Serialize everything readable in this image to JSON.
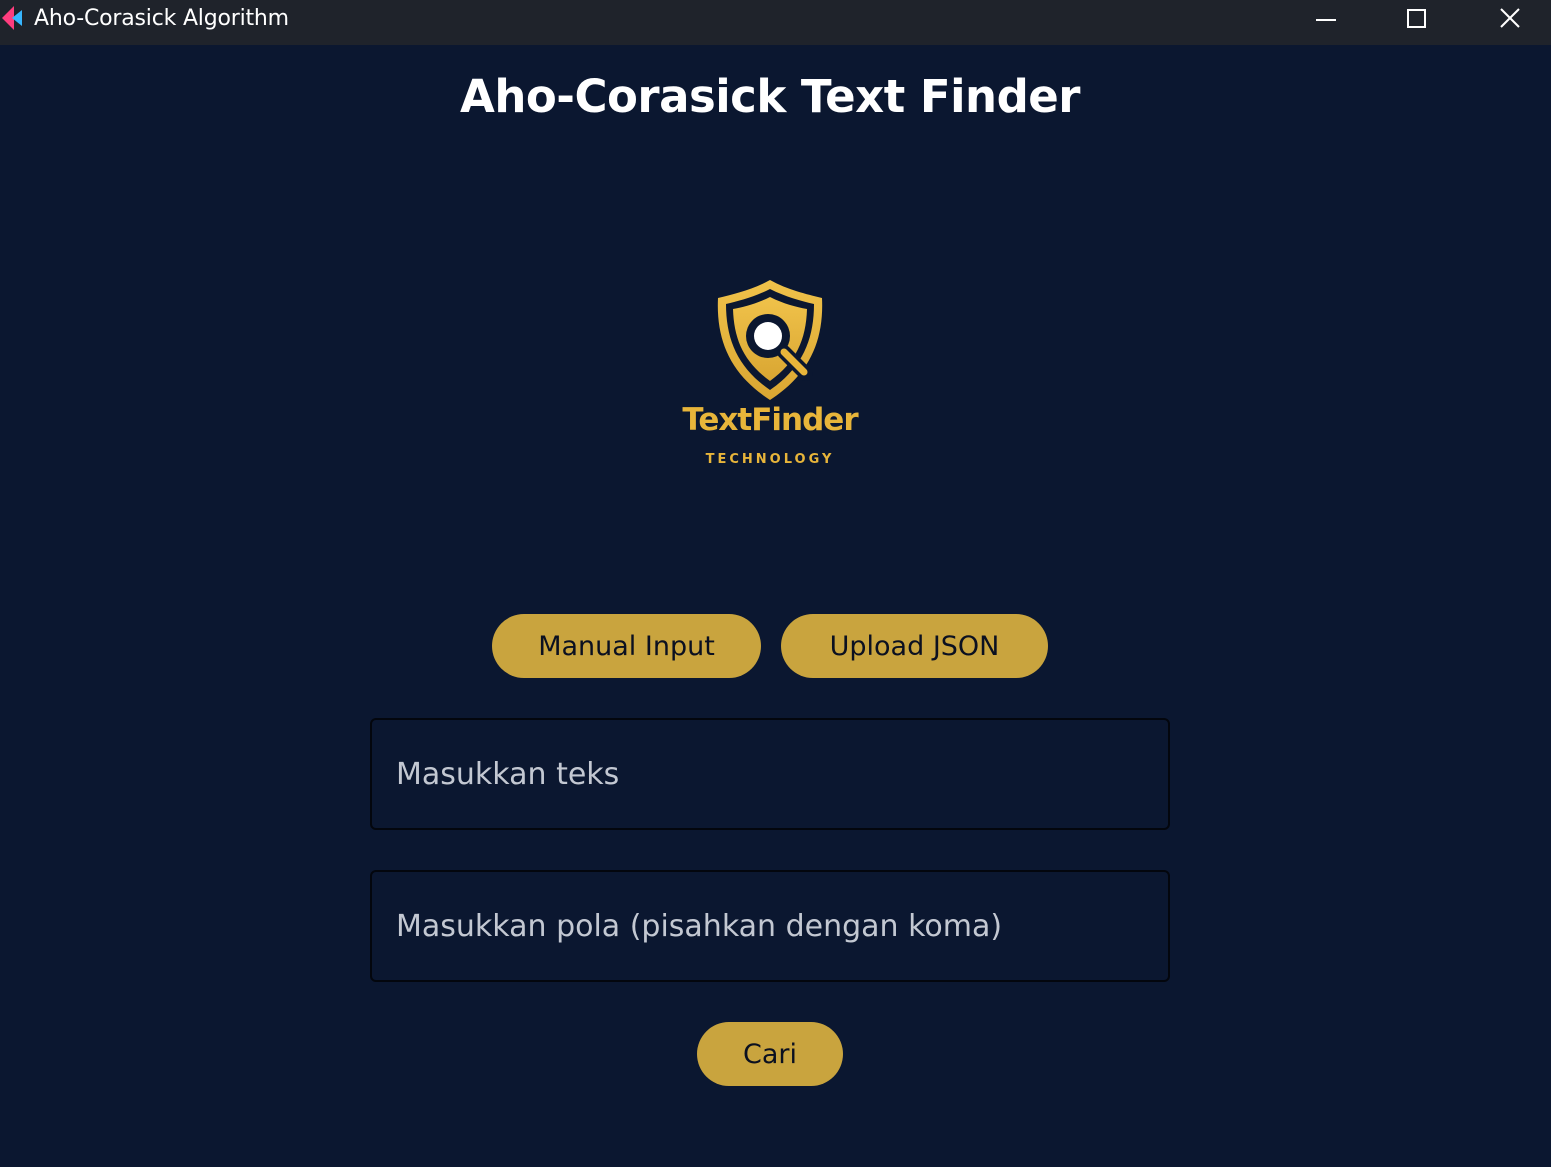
{
  "window": {
    "title": "Aho-Corasick Algorithm",
    "controls": [
      "minimize",
      "maximize",
      "close"
    ]
  },
  "page": {
    "title": "Aho-Corasick Text Finder"
  },
  "logo": {
    "wordmark": "TextFinder",
    "tagline": "TECHNOLOGY",
    "icon": "shield-magnifier-icon"
  },
  "mode_buttons": {
    "manual_label": "Manual Input",
    "upload_label": "Upload JSON"
  },
  "inputs": {
    "text": {
      "value": "",
      "placeholder": "Masukkan teks"
    },
    "patterns": {
      "value": "",
      "placeholder": "Masukkan pola (pisahkan dengan koma)"
    }
  },
  "actions": {
    "search_label": "Cari"
  },
  "colors": {
    "background": "#0b1730",
    "titlebar": "#1f232b",
    "accent": "#c9a43e",
    "logo_gold": "#e8b53a"
  }
}
